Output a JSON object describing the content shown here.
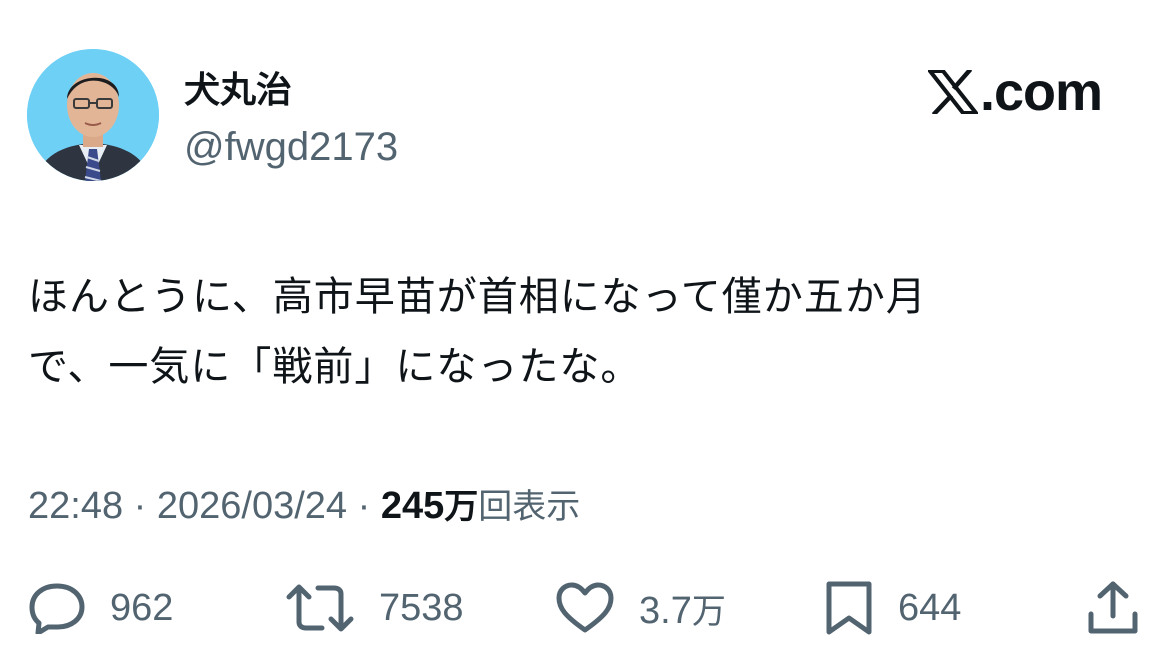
{
  "author": {
    "display_name": "犬丸治",
    "handle": "@fwgd2173"
  },
  "brand": {
    "domain": ".com",
    "icon": "x-logo-icon"
  },
  "tweet": {
    "text": "ほんとうに、高市早苗が首相になって僅か五か月\nで、一気に「戦前」になったな。",
    "time": "22:48",
    "separator_1": " · ",
    "date": "2026/03/24",
    "separator_2": " · ",
    "views_count": "245",
    "views_unit": "万",
    "views_label": "回表示"
  },
  "actions": {
    "replies": {
      "icon": "reply-icon",
      "count": "962"
    },
    "reposts": {
      "icon": "repost-icon",
      "count": "7538"
    },
    "likes": {
      "icon": "like-icon",
      "count_number": "3.7",
      "count_unit": "万"
    },
    "bookmarks": {
      "icon": "bookmark-icon",
      "count": "644"
    },
    "share": {
      "icon": "share-icon"
    }
  },
  "colors": {
    "text_primary": "#0f1419",
    "text_secondary": "#536471",
    "avatar_background": "#6fd0f5"
  }
}
